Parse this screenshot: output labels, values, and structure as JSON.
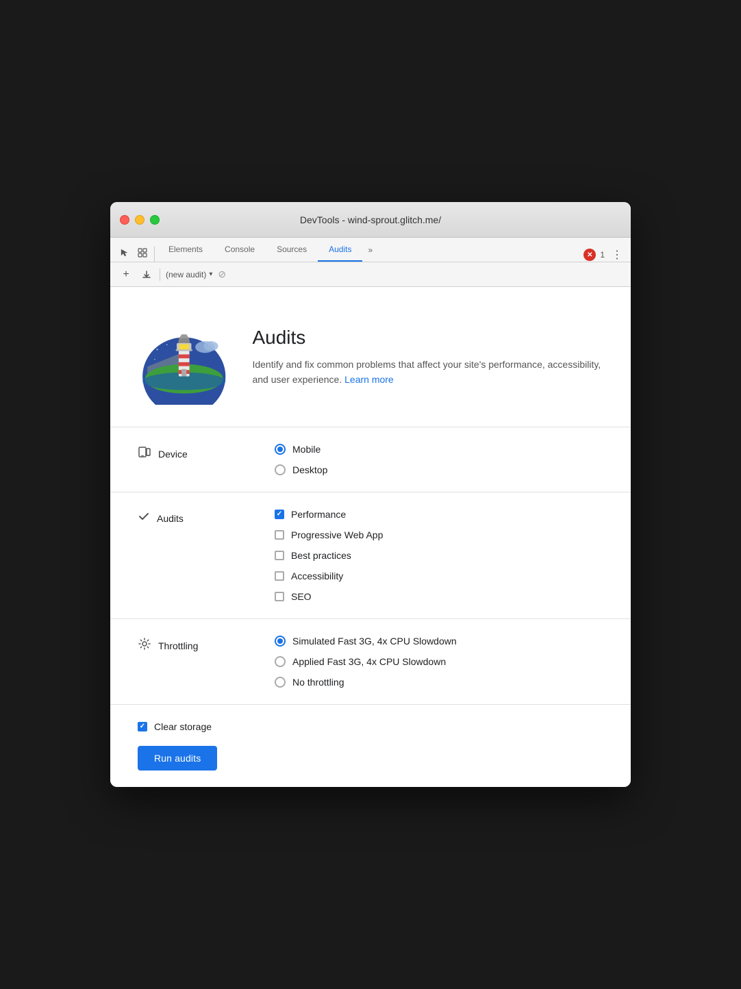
{
  "window": {
    "title": "DevTools - wind-sprout.glitch.me/"
  },
  "tabs": {
    "items": [
      {
        "label": "Elements",
        "active": false
      },
      {
        "label": "Console",
        "active": false
      },
      {
        "label": "Sources",
        "active": false
      },
      {
        "label": "Audits",
        "active": true
      }
    ],
    "more_label": "»",
    "error_count": "1",
    "menu_label": "⋮"
  },
  "audit_toolbar": {
    "new_audit_label": "(new audit)"
  },
  "hero": {
    "title": "Audits",
    "description": "Identify and fix common problems that affect your site's performance, accessibility, and user experience.",
    "learn_more_label": "Learn more"
  },
  "device": {
    "label": "Device",
    "options": [
      {
        "label": "Mobile",
        "selected": true
      },
      {
        "label": "Desktop",
        "selected": false
      }
    ]
  },
  "audits": {
    "label": "Audits",
    "options": [
      {
        "label": "Performance",
        "checked": true
      },
      {
        "label": "Progressive Web App",
        "checked": false
      },
      {
        "label": "Best practices",
        "checked": false
      },
      {
        "label": "Accessibility",
        "checked": false
      },
      {
        "label": "SEO",
        "checked": false
      }
    ]
  },
  "throttling": {
    "label": "Throttling",
    "options": [
      {
        "label": "Simulated Fast 3G, 4x CPU Slowdown",
        "selected": true
      },
      {
        "label": "Applied Fast 3G, 4x CPU Slowdown",
        "selected": false
      },
      {
        "label": "No throttling",
        "selected": false
      }
    ]
  },
  "bottom": {
    "clear_storage_label": "Clear storage",
    "clear_storage_checked": true,
    "run_button_label": "Run audits"
  }
}
